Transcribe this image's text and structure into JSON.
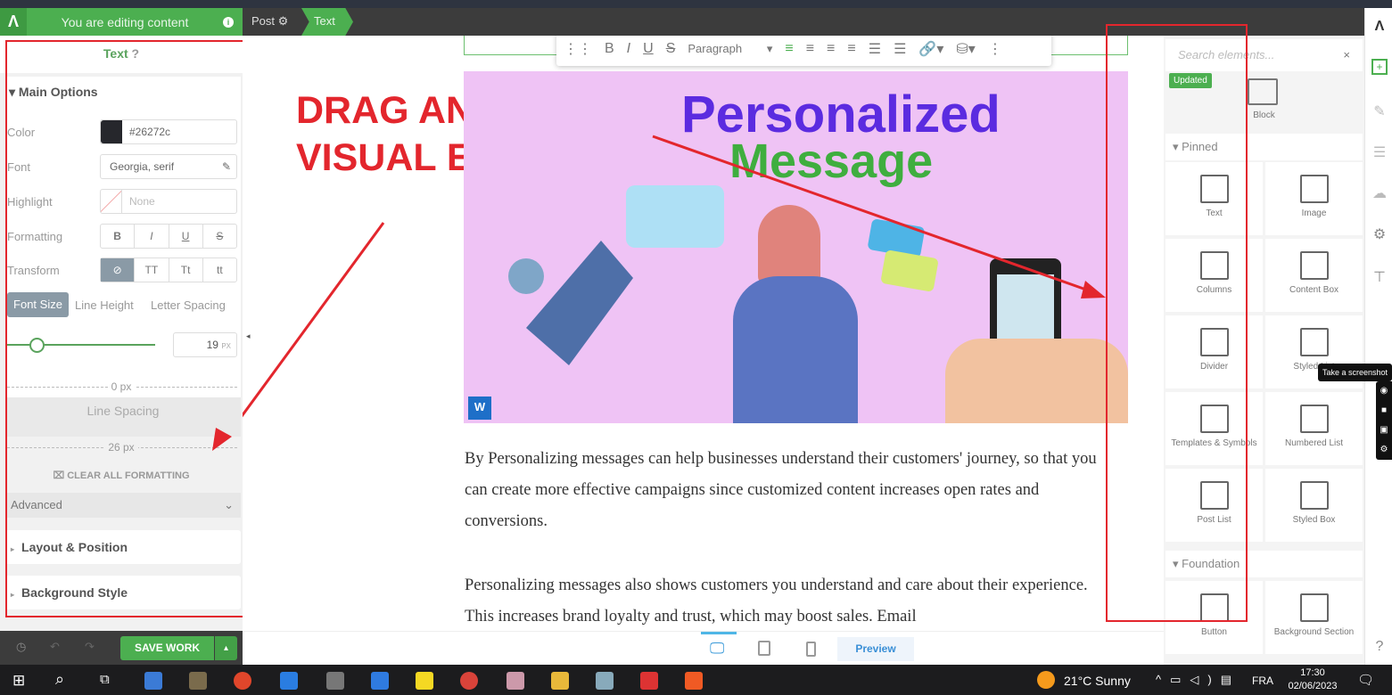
{
  "topbar": {
    "editing_label": "You are editing content",
    "crumbs": [
      "Post",
      "Text"
    ]
  },
  "left_panel": {
    "title": "Text",
    "main_options": "Main Options",
    "color_label": "Color",
    "color_value": "#26272c",
    "font_label": "Font",
    "font_value": "Georgia, serif",
    "highlight_label": "Highlight",
    "highlight_value": "None",
    "formatting_label": "Formatting",
    "formatting": [
      "B",
      "I",
      "U",
      "S"
    ],
    "transform_label": "Transform",
    "transform": [
      "⊘",
      "TT",
      "Tt",
      "tt"
    ],
    "tabs": [
      "Font Size",
      "Line Height",
      "Letter Spacing"
    ],
    "font_size": 19,
    "font_size_unit": "PX",
    "spacing_top": "0 px",
    "line_spacing": "Line Spacing",
    "spacing_bottom": "26 px",
    "clear_formatting": "CLEAR ALL FORMATTING",
    "advanced": "Advanced",
    "layout_position": "Layout & Position",
    "background_style": "Background Style",
    "save_work": "SAVE WORK"
  },
  "canvas": {
    "annotation": [
      "DRAG AND DROP",
      "VISUAL EDITOR"
    ],
    "toolbar": {
      "paragraph": "Paragraph"
    },
    "hero": {
      "line1": "Personalized",
      "line2": "Message",
      "badge": "W"
    },
    "paragraphs": [
      "By Personalizing messages can help businesses understand their customers' journey, so that you can create more effective campaigns since customized content increases open rates and conversions.",
      "Personalizing messages also shows customers you understand and care about their experience. This increases brand loyalty and trust, which may boost sales. Email"
    ],
    "preview": "Preview"
  },
  "right_panel": {
    "search_placeholder": "Search elements...",
    "updated_badge": "Updated",
    "block": "Block",
    "pinned": "Pinned",
    "pinned_items": [
      "Text",
      "Image",
      "Columns",
      "Content Box",
      "Divider",
      "Styled List",
      "Templates & Symbols",
      "Numbered List",
      "Post List",
      "Styled Box"
    ],
    "foundation": "Foundation",
    "foundation_items": [
      "Button",
      "Background Section"
    ],
    "tooltip": "Take a screenshot"
  },
  "taskbar": {
    "weather": "21°C  Sunny",
    "lang": "FRA",
    "time": "17:30",
    "date": "02/06/2023",
    "notif": "1"
  },
  "colors": {
    "accent": "#4caf50",
    "annotation": "#e3262d",
    "hero_bg": "#efc3f5"
  }
}
